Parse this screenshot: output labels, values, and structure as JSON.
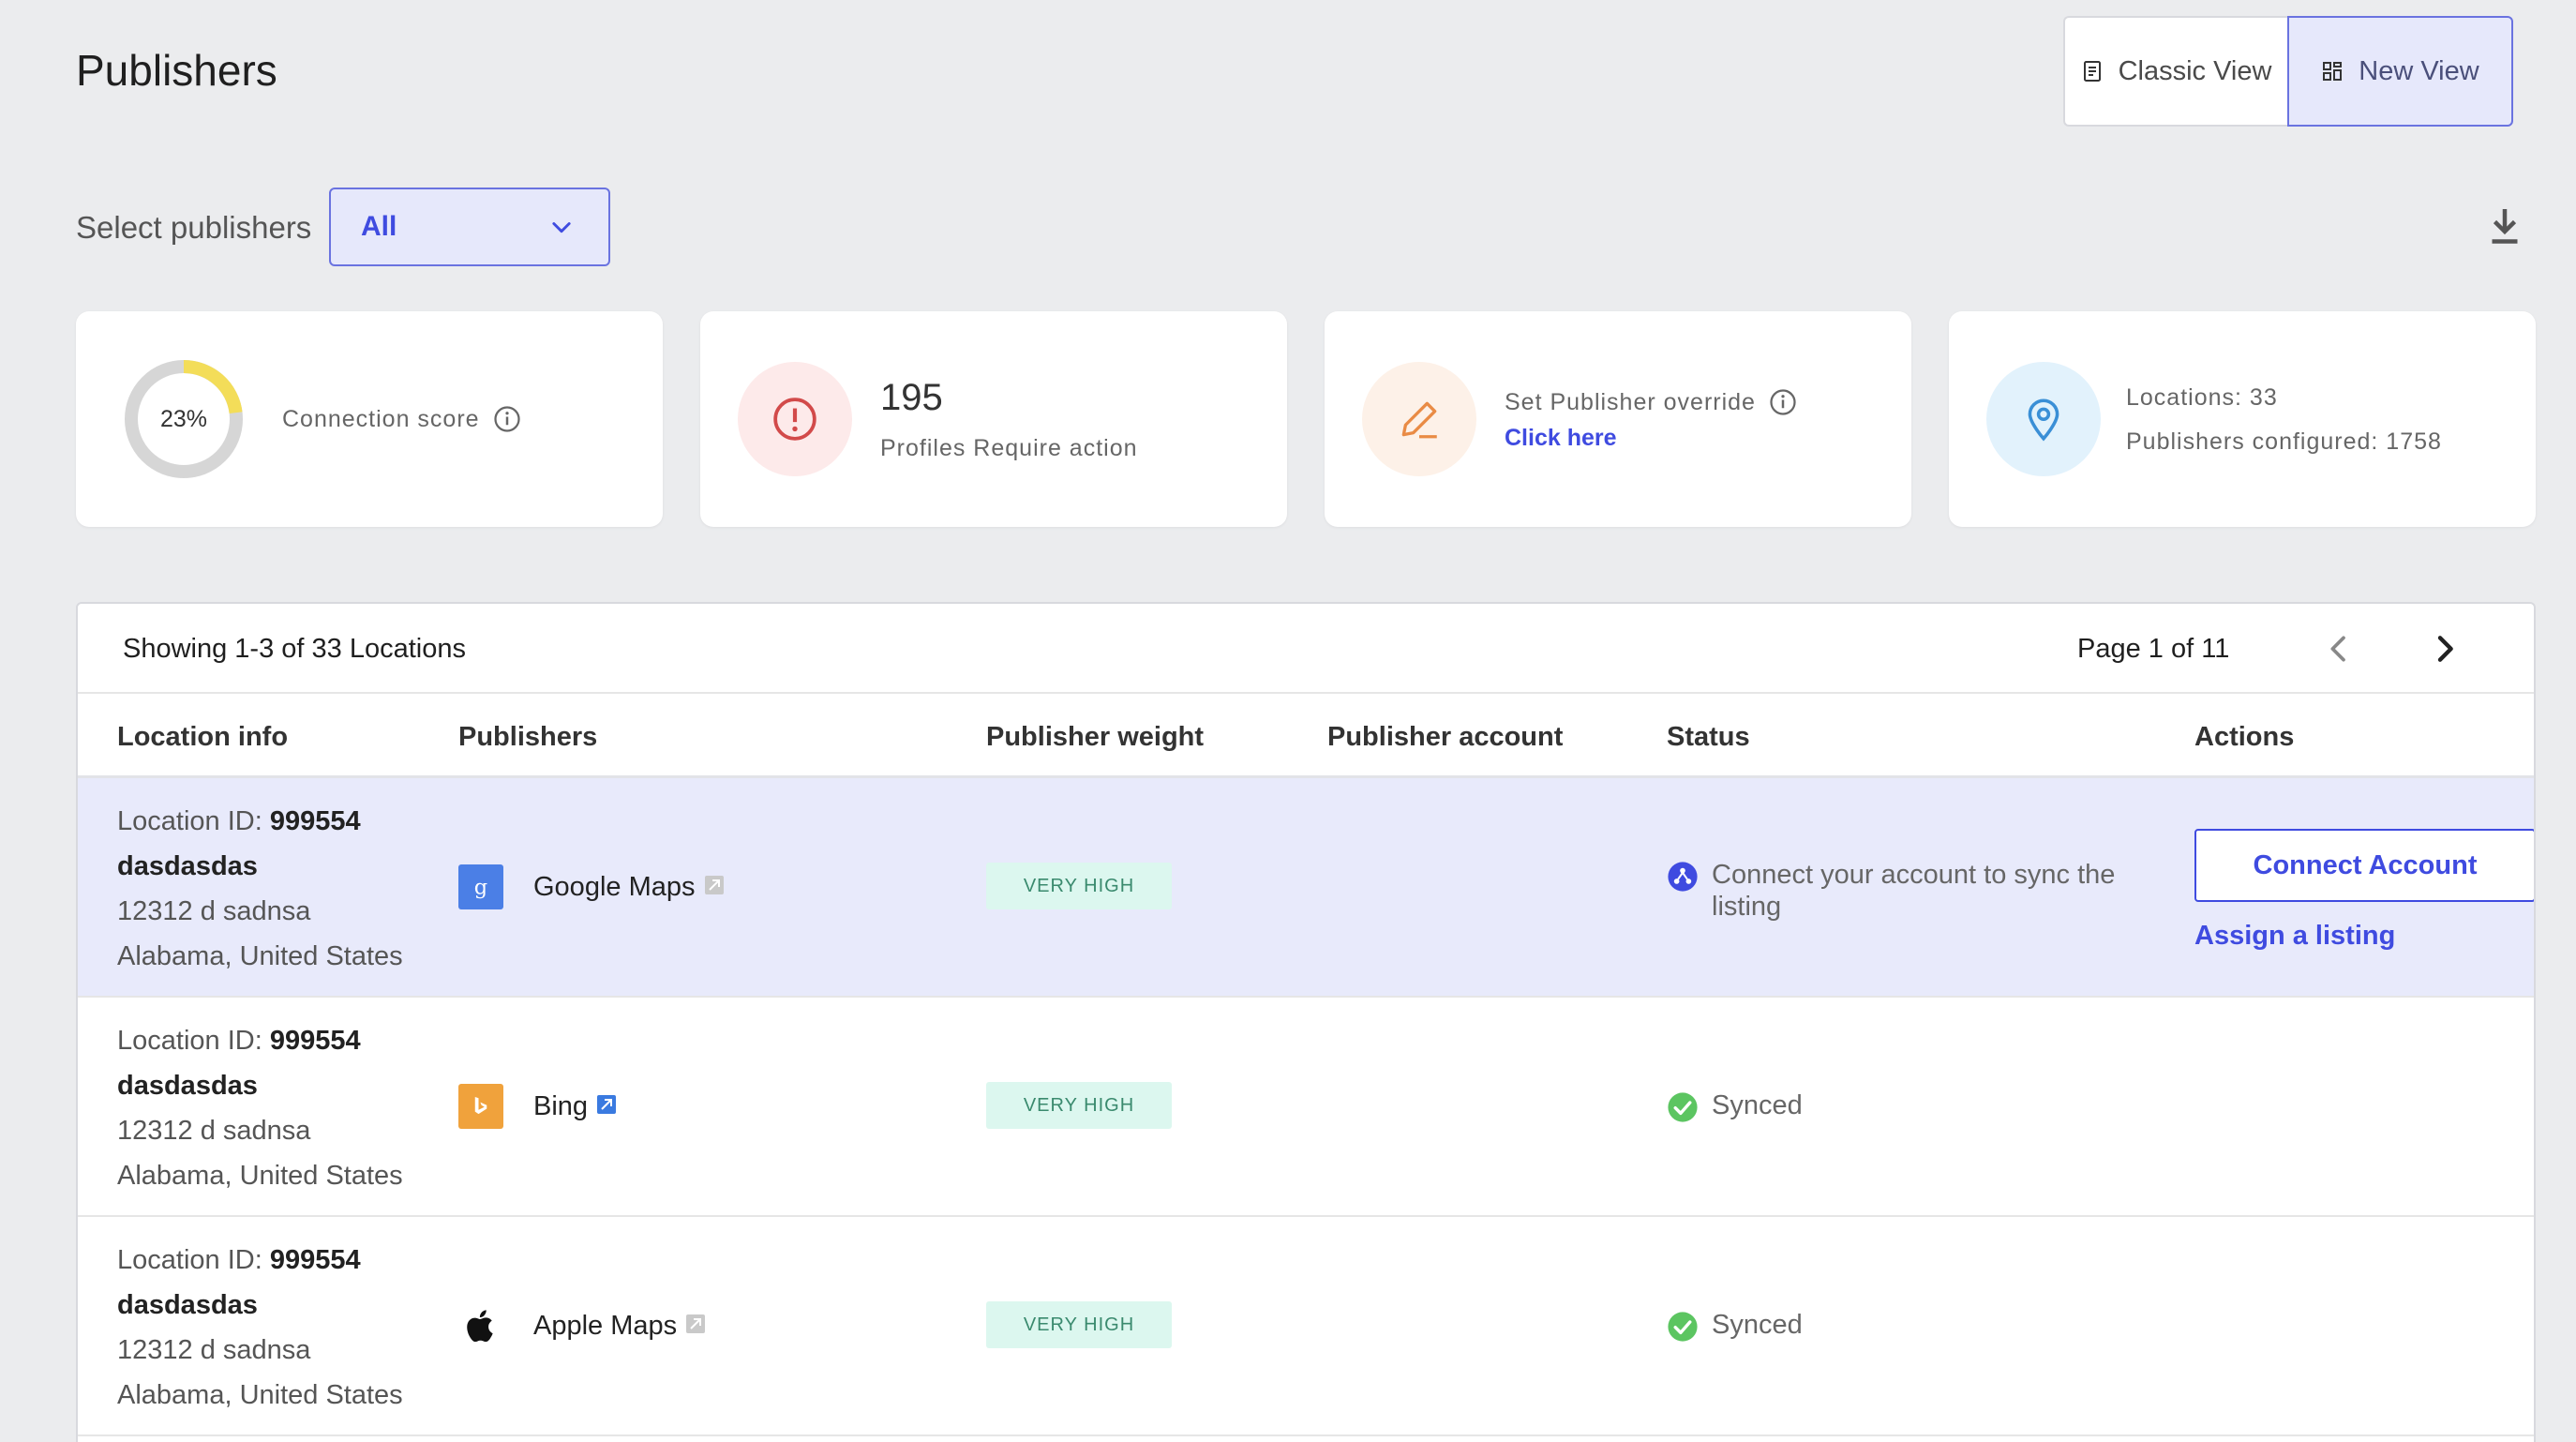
{
  "page": {
    "title": "Publishers"
  },
  "view_toggle": {
    "classic_label": "Classic View",
    "new_label": "New View",
    "active": "New View"
  },
  "filter": {
    "label": "Select publishers",
    "value": "All"
  },
  "cards": {
    "connection": {
      "percent_text": "23%",
      "percent": 23,
      "label": "Connection score"
    },
    "profiles": {
      "count": "195",
      "label": "Profiles Require action"
    },
    "override": {
      "label": "Set Publisher override",
      "link": "Click here"
    },
    "locations": {
      "line1": "Locations: 33",
      "line2": "Publishers configured: 1758"
    }
  },
  "table": {
    "showing": "Showing 1-3 of 33 Locations",
    "page_info": "Page 1 of 11",
    "headers": {
      "location": "Location info",
      "publishers": "Publishers",
      "weight": "Publisher weight",
      "account": "Publisher account",
      "status": "Status",
      "actions": "Actions"
    },
    "rows": [
      {
        "id_label": "Location ID: ",
        "id": "999554",
        "name": "dasdasdas",
        "address": "12312 d sadnsa",
        "region": "Alabama, United States",
        "publisher": "Google Maps",
        "publisher_icon": "google-maps-icon",
        "weight": "VERY HIGH",
        "status": "Connect your account to sync the listing",
        "status_icon": "connect-icon",
        "action_button": "Connect Account",
        "action_link": "Assign a listing"
      },
      {
        "id_label": "Location ID: ",
        "id": "999554",
        "name": "dasdasdas",
        "address": "12312 d sadnsa",
        "region": "Alabama, United States",
        "publisher": "Bing",
        "publisher_icon": "bing-icon",
        "weight": "VERY HIGH",
        "status": "Synced",
        "status_icon": "check-icon"
      },
      {
        "id_label": "Location ID: ",
        "id": "999554",
        "name": "dasdasdas",
        "address": "12312 d sadnsa",
        "region": "Alabama, United States",
        "publisher": "Apple Maps",
        "publisher_icon": "apple-icon",
        "weight": "VERY HIGH",
        "status": "Synced",
        "status_icon": "check-icon"
      }
    ]
  },
  "colors": {
    "accent": "#3f4be0",
    "background": "#ebecee",
    "row_highlight": "#e8eafb",
    "badge_bg": "#dcf7ef",
    "synced_green": "#5cc561",
    "score_track": "#d6d6d6",
    "score_fill": "#f3dd59"
  }
}
